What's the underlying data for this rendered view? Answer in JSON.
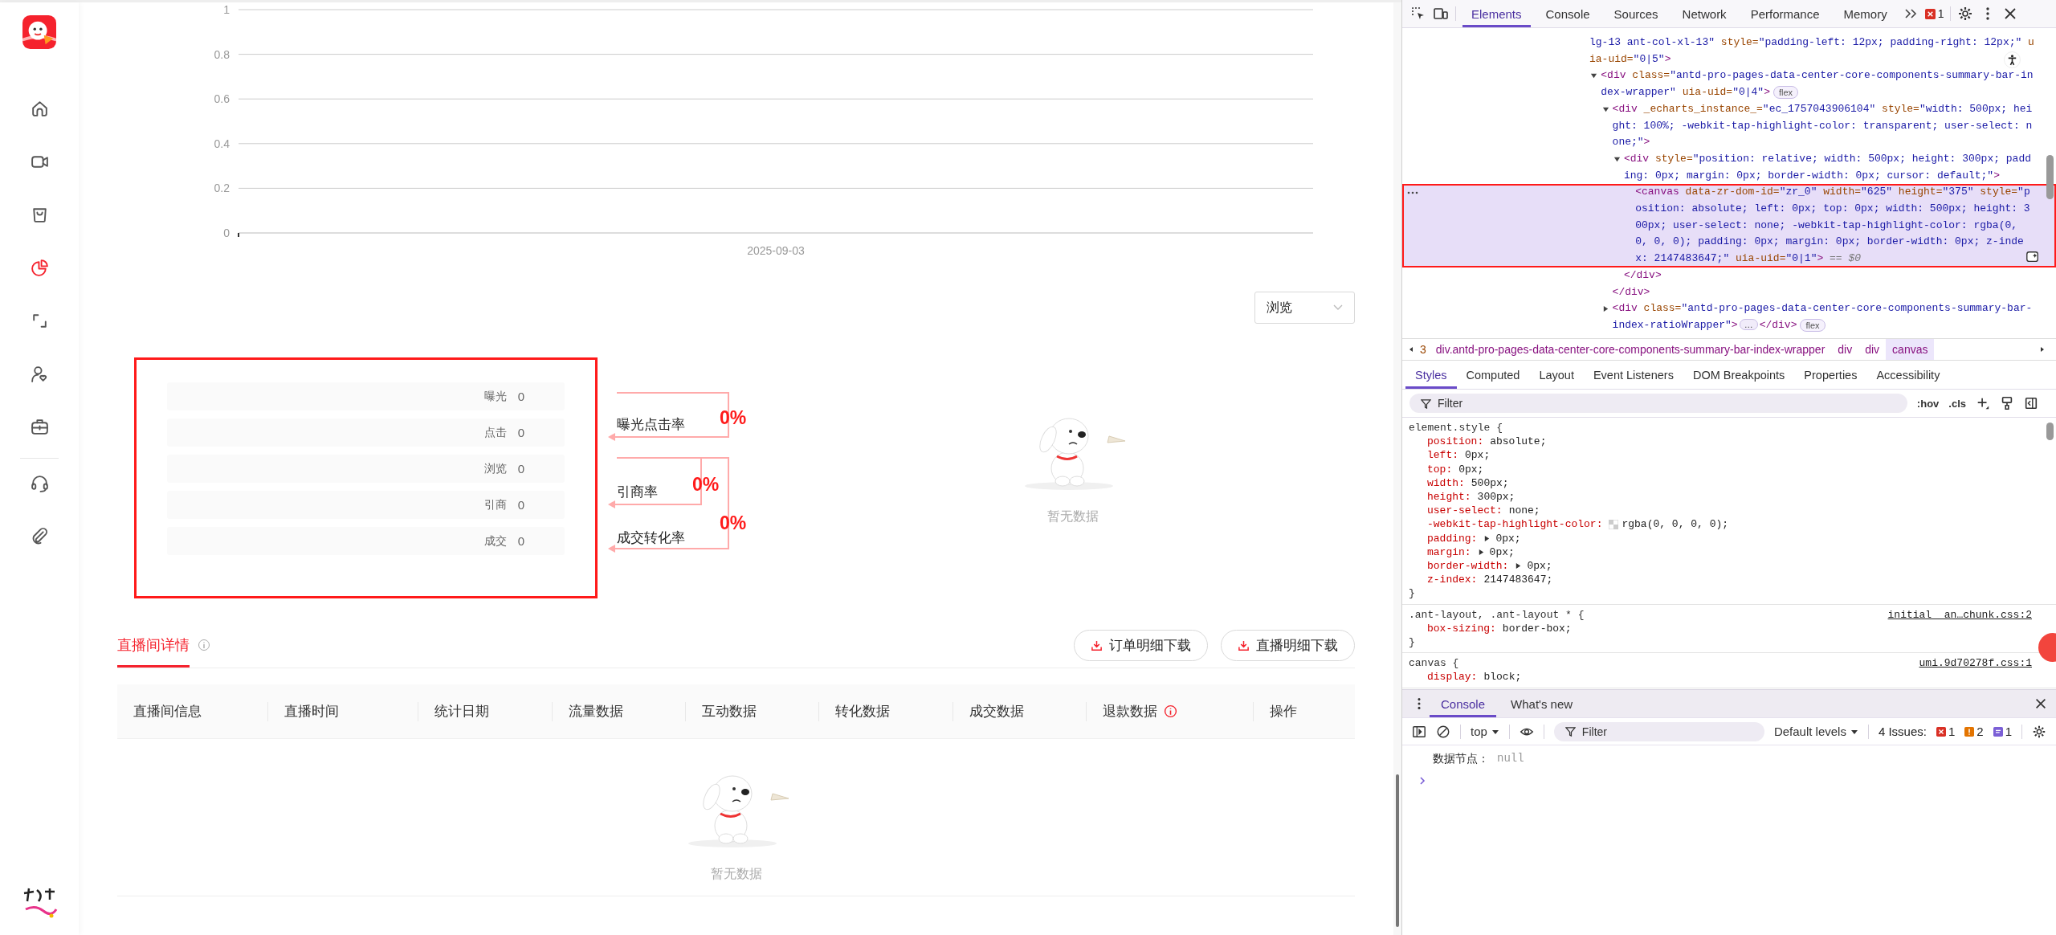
{
  "sidebar": {
    "groups": [
      {
        "items": [
          {
            "kind": "home",
            "selected": false
          },
          {
            "kind": "video",
            "selected": false
          },
          {
            "kind": "bag",
            "selected": false
          },
          {
            "kind": "pie",
            "selected": true
          },
          {
            "kind": "frame",
            "selected": false
          },
          {
            "kind": "user",
            "selected": false
          },
          {
            "kind": "briefcase",
            "selected": false
          }
        ]
      },
      {
        "items": [
          {
            "kind": "headset",
            "selected": false
          },
          {
            "kind": "clip",
            "selected": false
          }
        ]
      }
    ]
  },
  "trend_chart": {
    "chart_data": {
      "type": "line",
      "grid": true,
      "categories": [
        "2025-09-03"
      ],
      "series": [
        {
          "values": [
            null
          ]
        }
      ],
      "ylim": [
        0,
        1
      ],
      "yticks": [
        0,
        0.2,
        0.4,
        0.6,
        0.8,
        1
      ]
    }
  },
  "metric_select": {
    "value": "浏览"
  },
  "funnel": {
    "annotated": true,
    "stages": [
      {
        "label": "曝光",
        "value": "0"
      },
      {
        "label": "点击",
        "value": "0"
      },
      {
        "label": "浏览",
        "value": "0"
      },
      {
        "label": "引商",
        "value": "0"
      },
      {
        "label": "成交",
        "value": "0"
      }
    ],
    "rates": [
      {
        "label": "曝光点击率",
        "value": "0%"
      },
      {
        "label": "引商率",
        "value": "0%"
      },
      {
        "label": "成交转化率",
        "value": "0%"
      }
    ],
    "empty_text": "暂无数据"
  },
  "details": {
    "tabs": [
      {
        "label": "直播间详情",
        "selected": true
      }
    ],
    "buttons": [
      "订单明细下载",
      "直播明细下载"
    ],
    "columns": [
      {
        "label": "直播间信息",
        "kind": "plain"
      },
      {
        "label": "直播时间",
        "kind": "plain"
      },
      {
        "label": "统计日期",
        "kind": "plain"
      },
      {
        "label": "流量数据",
        "kind": "plain"
      },
      {
        "label": "互动数据",
        "kind": "plain"
      },
      {
        "label": "转化数据",
        "kind": "plain"
      },
      {
        "label": "成交数据",
        "kind": "plain"
      },
      {
        "label": "退款数据",
        "kind": "info"
      },
      {
        "label": "操作",
        "kind": "plain"
      }
    ],
    "empty_text": "暂无数据"
  },
  "devtools": {
    "tabs": [
      {
        "label": "Elements",
        "selected": true
      },
      {
        "label": "Console",
        "selected": false
      },
      {
        "label": "Sources",
        "selected": false
      },
      {
        "label": "Network",
        "selected": false
      },
      {
        "label": "Performance",
        "selected": false
      },
      {
        "label": "Memory",
        "selected": false
      }
    ],
    "error_count": "1",
    "tree": [
      {
        "selected": false,
        "annotated": false,
        "parts": [
          {
            "kind": "val",
            "text": "lg-13 ant-col-xl-13\""
          },
          {
            "kind": "attr",
            "text": " style="
          },
          {
            "kind": "val",
            "text": "\"padding-left: 12px; padding-right: 12px;\""
          },
          {
            "kind": "attr",
            "text": " uia-uid="
          },
          {
            "kind": "val",
            "text": "\"0|5\""
          },
          {
            "kind": "tag",
            "text": ">"
          }
        ],
        "children": [
          {
            "selected": false,
            "annotated": false,
            "expanded": true,
            "badge": "flex",
            "parts": [
              {
                "kind": "tag",
                "text": "<div"
              },
              {
                "kind": "attr",
                "text": " class="
              },
              {
                "kind": "val",
                "text": "\"antd-pro-pages-data-center-core-components-summary-bar-index-wrapper\""
              },
              {
                "kind": "attr",
                "text": " uia-uid="
              },
              {
                "kind": "val",
                "text": "\"0|4\""
              },
              {
                "kind": "tag",
                "text": ">"
              }
            ],
            "children": [
              {
                "selected": false,
                "annotated": false,
                "expanded": true,
                "parts": [
                  {
                    "kind": "tag",
                    "text": "<div"
                  },
                  {
                    "kind": "attr",
                    "text": " _echarts_instance_="
                  },
                  {
                    "kind": "val",
                    "text": "\"ec_1757043906104\""
                  },
                  {
                    "kind": "attr",
                    "text": " style="
                  },
                  {
                    "kind": "val",
                    "text": "\"width: 500px; height: 100%; -webkit-tap-highlight-color: transparent; user-select: none;\""
                  },
                  {
                    "kind": "tag",
                    "text": ">"
                  }
                ],
                "close": "</div>",
                "children": [
                  {
                    "selected": false,
                    "annotated": false,
                    "expanded": true,
                    "parts": [
                      {
                        "kind": "tag",
                        "text": "<div"
                      },
                      {
                        "kind": "attr",
                        "text": " style="
                      },
                      {
                        "kind": "val",
                        "text": "\"position: relative; width: 500px; height: 300px; padding: 0px; margin: 0px; border-width: 0px; cursor: default;\""
                      },
                      {
                        "kind": "tag",
                        "text": ">"
                      }
                    ],
                    "close": "</div>",
                    "children": [
                      {
                        "selected": true,
                        "annotated": true,
                        "suffix": " == $0",
                        "parts": [
                          {
                            "kind": "tag",
                            "text": "<canvas"
                          },
                          {
                            "kind": "attr",
                            "text": " data-zr-dom-id="
                          },
                          {
                            "kind": "val",
                            "text": "\"zr_0\""
                          },
                          {
                            "kind": "attr",
                            "text": " width="
                          },
                          {
                            "kind": "val",
                            "text": "\"625\""
                          },
                          {
                            "kind": "attr",
                            "text": " height="
                          },
                          {
                            "kind": "val",
                            "text": "\"375\""
                          },
                          {
                            "kind": "attr",
                            "text": " style="
                          },
                          {
                            "kind": "val",
                            "text": "\"position: absolute; left: 0px; top: 0px; width: 500px; height: 300px; user-select: none; -webkit-tap-highlight-color: rgba(0, 0, 0, 0); padding: 0px; margin: 0px; border-width: 0px; z-index: 2147483647;\""
                          },
                          {
                            "kind": "attr",
                            "text": " uia-uid="
                          },
                          {
                            "kind": "val",
                            "text": "\"0|1\""
                          },
                          {
                            "kind": "tag",
                            "text": ">"
                          }
                        ]
                      }
                    ]
                  }
                ]
              },
              {
                "selected": false,
                "annotated": false,
                "expanded": false,
                "badge": "flex",
                "ellipsis": "…",
                "close": "</div>",
                "parts": [
                  {
                    "kind": "tag",
                    "text": "<div"
                  },
                  {
                    "kind": "attr",
                    "text": " class="
                  },
                  {
                    "kind": "val",
                    "text": "\"antd-pro-pages-data-center-core-components-summary-bar-index-ratioWrapper\""
                  },
                  {
                    "kind": "tag",
                    "text": ">"
                  }
                ]
              }
            ]
          }
        ]
      }
    ],
    "breadcrumb": [
      {
        "label": "3",
        "selected": false
      },
      {
        "label": "div.antd-pro-pages-data-center-core-components-summary-bar-index-wrapper",
        "selected": false
      },
      {
        "label": "div",
        "selected": false
      },
      {
        "label": "div",
        "selected": false
      },
      {
        "label": "canvas",
        "selected": true
      }
    ],
    "styles_tabs": [
      {
        "label": "Styles",
        "selected": true
      },
      {
        "label": "Computed",
        "selected": false
      },
      {
        "label": "Layout",
        "selected": false
      },
      {
        "label": "Event Listeners",
        "selected": false
      },
      {
        "label": "DOM Breakpoints",
        "selected": false
      },
      {
        "label": "Properties",
        "selected": false
      },
      {
        "label": "Accessibility",
        "selected": false
      }
    ],
    "filter_placeholder": "Filter",
    "style_tools": [
      ":hov",
      ".cls"
    ],
    "rules": [
      {
        "selector": "element.style {",
        "close": "}",
        "decls": [
          {
            "kind": "plain",
            "name": "position:",
            "value": "absolute;"
          },
          {
            "kind": "plain",
            "name": "left:",
            "value": "0px;"
          },
          {
            "kind": "plain",
            "name": "top:",
            "value": "0px;"
          },
          {
            "kind": "plain",
            "name": "width:",
            "value": "500px;"
          },
          {
            "kind": "plain",
            "name": "height:",
            "value": "300px;"
          },
          {
            "kind": "plain",
            "name": "user-select:",
            "value": "none;"
          },
          {
            "kind": "color",
            "name": "-webkit-tap-highlight-color:",
            "value": "rgba(0, 0, 0, 0);"
          },
          {
            "kind": "shorthand",
            "name": "padding:",
            "value": "0px;"
          },
          {
            "kind": "shorthand",
            "name": "margin:",
            "value": "0px;"
          },
          {
            "kind": "shorthand",
            "name": "border-width:",
            "value": "0px;"
          },
          {
            "kind": "plain",
            "name": "z-index:",
            "value": "2147483647;"
          }
        ]
      },
      {
        "selector": ".ant-layout, .ant-layout * {",
        "source": "initial__an…chunk.css:2",
        "close": "}",
        "decls": [
          {
            "kind": "plain",
            "name": "box-sizing:",
            "value": "border-box;"
          }
        ]
      },
      {
        "selector": "canvas {",
        "source": "umi.9d70278f.css:1",
        "decls": [
          {
            "kind": "plain",
            "name": "display:",
            "value": "block;"
          }
        ]
      }
    ],
    "drawer_tabs": [
      {
        "label": "Console",
        "selected": true
      },
      {
        "label": "What's new",
        "selected": false
      }
    ],
    "console": {
      "context": "top",
      "filter_placeholder": "Filter",
      "levels": "Default levels",
      "issues_label": "4 Issues:",
      "issue_counts": [
        {
          "kind": "error",
          "count": "1"
        },
        {
          "kind": "warning",
          "count": "2"
        },
        {
          "kind": "info",
          "count": "1"
        }
      ],
      "messages": [
        {
          "label": "数据节点：",
          "value": "null"
        }
      ]
    }
  }
}
